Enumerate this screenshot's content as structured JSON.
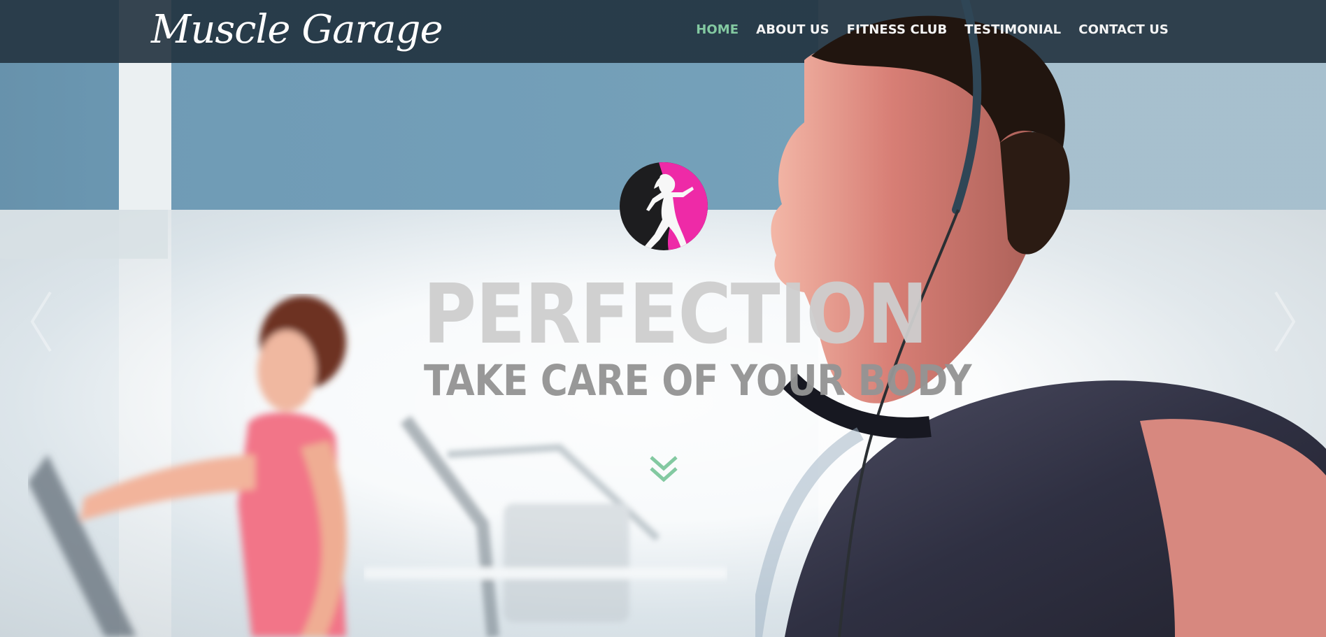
{
  "brand": {
    "name": "Muscle Garage"
  },
  "navigation": {
    "items": [
      {
        "label": "HOME",
        "active": true
      },
      {
        "label": "ABOUT US",
        "active": false
      },
      {
        "label": "FITNESS CLUB",
        "active": false
      },
      {
        "label": "TESTIMONIAL",
        "active": false
      },
      {
        "label": "CONTACT US",
        "active": false
      }
    ],
    "active_color": "#83c9a1",
    "text_color": "#f4f4f4"
  },
  "hero": {
    "title": "PERFECTION",
    "subtitle": "TAKE CARE OF YOUR BODY",
    "logo_icon": "fitness-silhouette-icon",
    "scroll_icon": "double-chevron-down-icon",
    "previous_icon": "chevron-left-icon",
    "next_icon": "chevron-right-icon",
    "accent_color": "#ee2aa7",
    "green_accent": "#83c9a1"
  }
}
